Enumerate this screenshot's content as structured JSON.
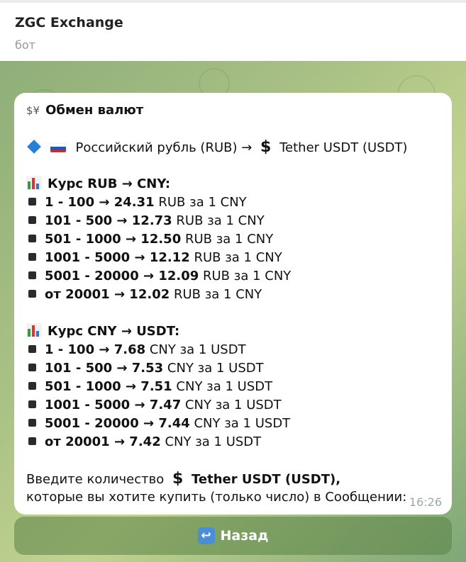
{
  "header": {
    "title": "ZGC Exchange",
    "subtitle": "бот"
  },
  "message": {
    "heading": "Обмен валют",
    "pair": {
      "from": "Российский рубль (RUB) →",
      "to": "Tether USDT (USDT)"
    },
    "section1": {
      "title": "Курс RUB → CNY:",
      "rows": [
        {
          "range": "1 - 100 → 24.31",
          "unit": " RUB за 1 CNY"
        },
        {
          "range": "101 - 500 → 12.73",
          "unit": " RUB за 1 CNY"
        },
        {
          "range": "501 - 1000 → 12.50",
          "unit": " RUB за 1 CNY"
        },
        {
          "range": "1001 - 5000 → 12.12",
          "unit": " RUB за 1 CNY"
        },
        {
          "range": "5001 - 20000 → 12.09",
          "unit": " RUB за 1 CNY"
        },
        {
          "range": "от 20001 → 12.02",
          "unit": " RUB за 1 CNY"
        }
      ]
    },
    "section2": {
      "title": "Курс CNY → USDT:",
      "rows": [
        {
          "range": "1 - 100 → 7.68",
          "unit": " CNY за 1 USDT"
        },
        {
          "range": "101 - 500 → 7.53",
          "unit": " CNY за 1 USDT"
        },
        {
          "range": "501 - 1000 → 7.51",
          "unit": " CNY за 1 USDT"
        },
        {
          "range": "1001 - 5000 → 7.47",
          "unit": " CNY за 1 USDT"
        },
        {
          "range": "5001 - 20000 → 7.44",
          "unit": " CNY за 1 USDT"
        },
        {
          "range": "от 20001 → 7.42",
          "unit": " CNY за 1 USDT"
        }
      ]
    },
    "prompt": {
      "prefix": "Введите количество",
      "currency": "Tether USDT (USDT),",
      "line2": "которые вы хотите купить (только число) в Сообщении:"
    },
    "time": "16:26",
    "symbol": "$"
  },
  "buttons": {
    "back_label": "Назад",
    "back_icon": "↩"
  },
  "icons": {
    "exchange": "exchange-icon",
    "chart": "chart-icon",
    "diamond": "blue-diamond-icon",
    "flag": "russia-flag-icon",
    "dollar": "dollar-icon"
  },
  "colors": {
    "accent": "#2a7fd4",
    "bubble": "#ffffff"
  }
}
